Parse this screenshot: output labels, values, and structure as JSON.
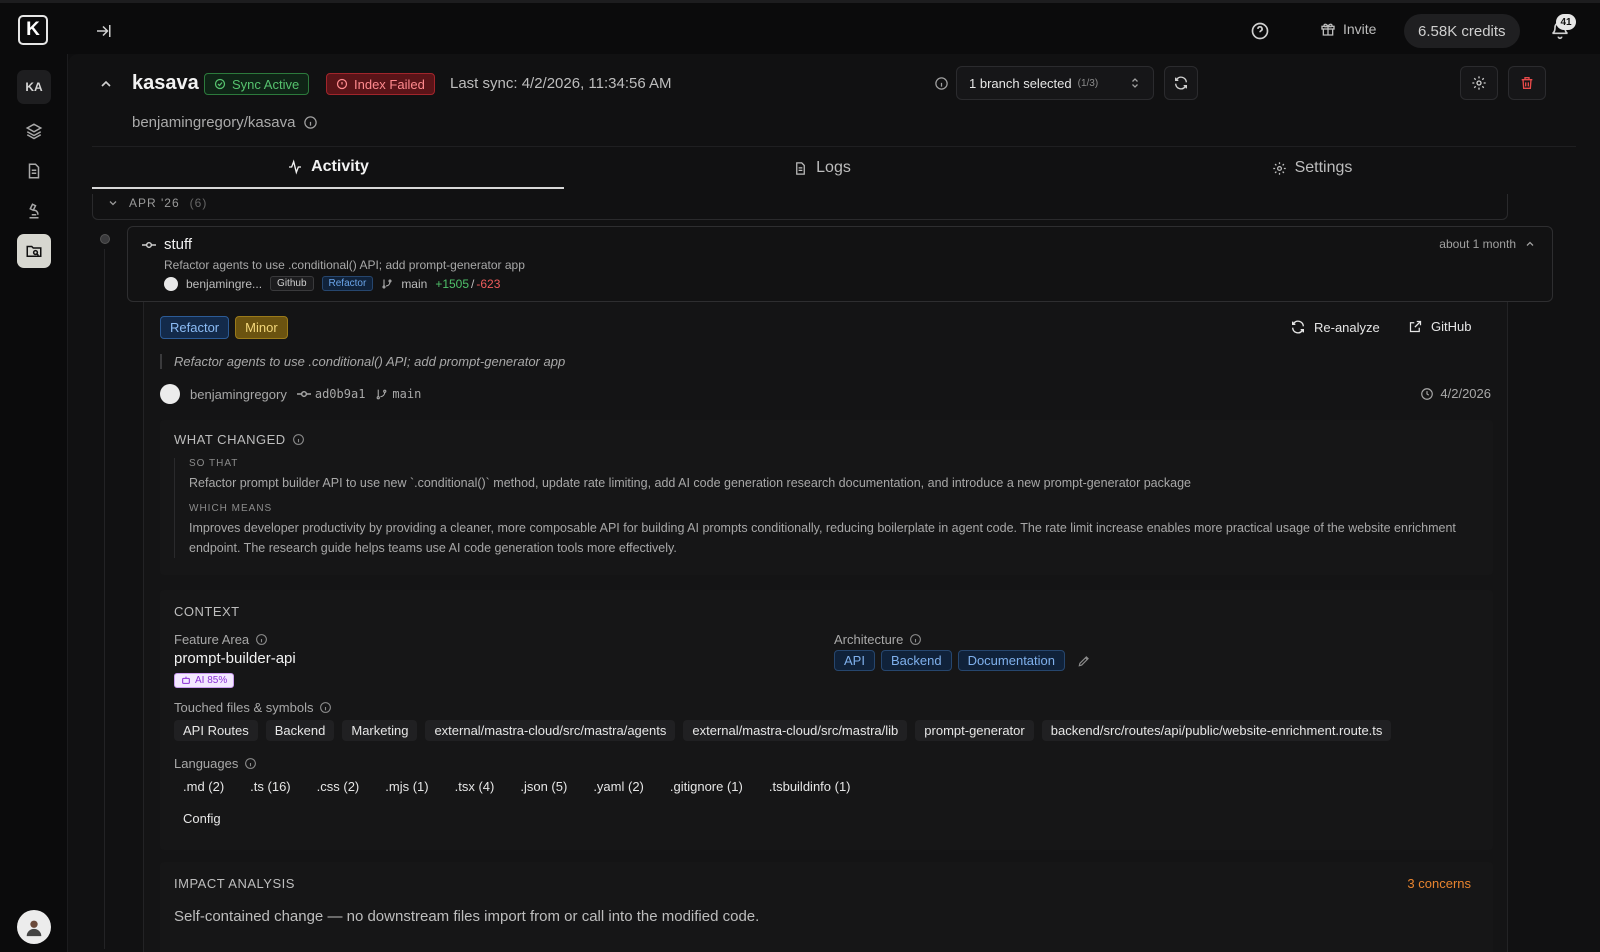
{
  "topbar": {
    "logo_letter": "K",
    "invite_label": "Invite",
    "credits_label": "6.58K credits",
    "notification_count": "41"
  },
  "sidebar": {
    "workspace_initials": "KA",
    "items": [
      "layers",
      "document",
      "microscope",
      "folder-search"
    ]
  },
  "repo": {
    "name": "kasava",
    "sync_badge": "Sync Active",
    "index_badge": "Index Failed",
    "last_sync": "Last sync: 4/2/2026, 11:34:56 AM",
    "path": "benjamingregory/kasava",
    "branch_label": "1 branch selected",
    "branch_count": "(1/3)"
  },
  "tabs": {
    "activity": "Activity",
    "logs": "Logs",
    "settings": "Settings"
  },
  "timeline": {
    "month_label": "APR '26",
    "month_count": "(6)"
  },
  "commit": {
    "title": "stuff",
    "ago": "about 1 month",
    "description": "Refactor agents to use .conditional() API; add prompt-generator app",
    "author_short": "benjamingre...",
    "source_tag": "Github",
    "type_tag": "Refactor",
    "branch": "main",
    "additions": "+1505",
    "separator": "/",
    "deletions": "-623"
  },
  "detail": {
    "type_pill": "Refactor",
    "size_pill": "Minor",
    "reanalyze_label": "Re-analyze",
    "github_label": "GitHub",
    "quote": "Refactor agents to use .conditional() API; add prompt-generator app",
    "author": "benjamingregory",
    "sha": "ad0b9a1",
    "branch": "main",
    "date": "4/2/2026"
  },
  "what_changed": {
    "title": "WHAT CHANGED",
    "so_that_label": "SO THAT",
    "so_that_text": "Refactor prompt builder API to use new `.conditional()` method, update rate limiting, add AI code generation research documentation, and introduce a new prompt-generator package",
    "which_means_label": "WHICH MEANS",
    "which_means_text": "Improves developer productivity by providing a cleaner, more composable API for building AI prompts conditionally, reducing boilerplate in agent code. The rate limit increase enables more practical usage of the website enrichment endpoint. The research guide helps teams use AI code generation tools more effectively."
  },
  "context": {
    "title": "CONTEXT",
    "feature_area_label": "Feature Area",
    "feature_area_value": "prompt-builder-api",
    "ai_confidence": "AI 85%",
    "architecture_label": "Architecture",
    "architecture_tags": [
      "API",
      "Backend",
      "Documentation"
    ],
    "touched_label": "Touched files & symbols",
    "touched": [
      "API Routes",
      "Backend",
      "Marketing",
      "external/mastra-cloud/src/mastra/agents",
      "external/mastra-cloud/src/mastra/lib",
      "prompt-generator",
      "backend/src/routes/api/public/website-enrichment.route.ts"
    ],
    "languages_label": "Languages",
    "languages": [
      ".md (2)",
      ".ts (16)",
      ".css (2)",
      ".mjs (1)",
      ".tsx (4)",
      ".json (5)",
      ".yaml (2)",
      ".gitignore (1)",
      ".tsbuildinfo (1)"
    ],
    "languages_extra": "Config"
  },
  "impact": {
    "title": "IMPACT ANALYSIS",
    "concerns": "3 concerns",
    "summary": "Self-contained change — no downstream files import from or call into the modified code."
  }
}
